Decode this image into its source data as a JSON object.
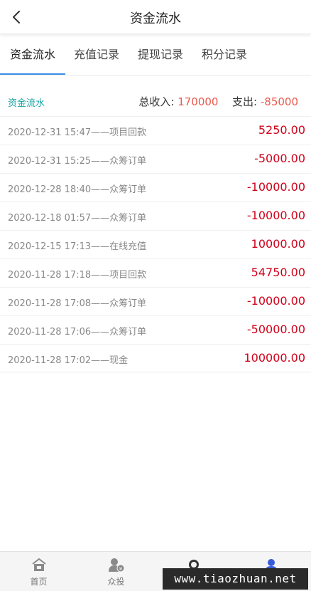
{
  "header": {
    "title": "资金流水"
  },
  "tabs": [
    {
      "label": "资金流水",
      "active": true
    },
    {
      "label": "充值记录",
      "active": false
    },
    {
      "label": "提现记录",
      "active": false
    },
    {
      "label": "积分记录",
      "active": false
    }
  ],
  "summary": {
    "label": "资金流水",
    "income_label": "总收入:",
    "income_value": "170000",
    "expense_label": "支出:",
    "expense_value": "-85000"
  },
  "transactions": [
    {
      "description": "2020-12-31 15:47——项目回款",
      "amount": "5250.00"
    },
    {
      "description": "2020-12-31 15:25——众筹订单",
      "amount": "-5000.00"
    },
    {
      "description": "2020-12-28 18:40——众筹订单",
      "amount": "-10000.00"
    },
    {
      "description": "2020-12-18 01:57——众筹订单",
      "amount": "-10000.00"
    },
    {
      "description": "2020-12-15 17:13——在线充值",
      "amount": "10000.00"
    },
    {
      "description": "2020-11-28 17:18——项目回款",
      "amount": "54750.00"
    },
    {
      "description": "2020-11-28 17:08——众筹订单",
      "amount": "-10000.00"
    },
    {
      "description": "2020-11-28 17:06——众筹订单",
      "amount": "-50000.00"
    },
    {
      "description": "2020-11-28 17:02——现金",
      "amount": "100000.00"
    }
  ],
  "bottom_nav": [
    {
      "label": "首页",
      "icon": "home-icon"
    },
    {
      "label": "众投",
      "icon": "invest-icon"
    },
    {
      "label": "",
      "icon": "message-icon"
    },
    {
      "label": "",
      "icon": "user-icon"
    }
  ],
  "watermark": "www.tiaozhuan.net",
  "colors": {
    "tab_underline": "#3a8ee6",
    "summary_label": "#19a3a3",
    "summary_number": "#e85a4f",
    "amount": "#d0021b",
    "nav_active": "#3a5bd9"
  }
}
